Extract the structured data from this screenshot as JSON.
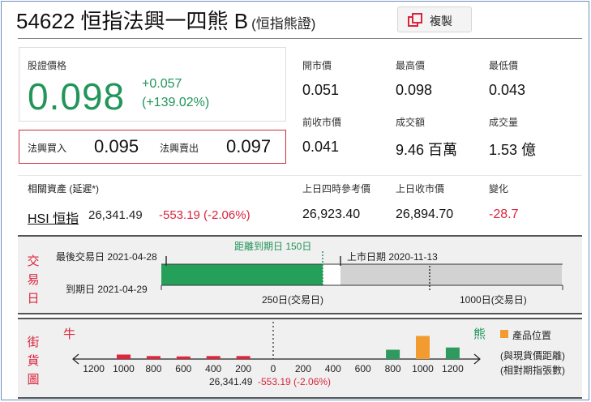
{
  "header": {
    "code_name": "54622 恒指法興一四熊 B",
    "subtitle": "(恒指熊證)",
    "copy_label": "複製"
  },
  "price": {
    "label": "股證價格",
    "value": "0.098",
    "change": "+0.057",
    "change_pct": "(+139.02%)"
  },
  "bid_ask": {
    "bid_label": "法興買入",
    "bid": "0.095",
    "ask_label": "法興賣出",
    "ask": "0.097"
  },
  "stats": [
    {
      "label": "開市價",
      "value": "0.051"
    },
    {
      "label": "最高價",
      "value": "0.098"
    },
    {
      "label": "最低價",
      "value": "0.043"
    },
    {
      "label": "前收市價",
      "value": "0.041"
    },
    {
      "label": "成交額",
      "value": "9.46 百萬"
    },
    {
      "label": "成交量",
      "value": "1.53 億"
    }
  ],
  "underlying": {
    "label": "相關資產 (延遲*)",
    "name": "HSI 恒指",
    "price": "26,341.49",
    "change": "-553.19 (-2.06%)",
    "ref_label": "上日四時參考價",
    "ref_value": "26,923.40",
    "close_label": "上日收市價",
    "close_value": "26,894.70",
    "chg_label": "變化",
    "chg_value": "-28.7"
  },
  "trading": {
    "side_label": [
      "交",
      "易",
      "日"
    ],
    "last_trade": "最後交易日 2021-04-28",
    "days_to_expiry": "距離到期日 150日",
    "listing": "上市日期 2020-11-13",
    "expiry": "到期日 2021-04-29",
    "scale_250": "250日(交易日)",
    "scale_1000": "1000日(交易日)",
    "elapsed_fraction": 0.6
  },
  "street": {
    "side_label": [
      "街",
      "貨",
      "圖"
    ],
    "bull_label": "牛",
    "bear_label": "熊",
    "legend_label": "產品位置",
    "note1": "(與現貨價距離)",
    "note2": "(相對期指張數)",
    "center_text": "26,341.49",
    "center_change": "-553.19 (-2.06%)",
    "ticks": [
      "1200",
      "1000",
      "800",
      "600",
      "400",
      "200",
      "0",
      "200",
      "400",
      "600",
      "800",
      "1000",
      "1200"
    ],
    "bull_bars": [
      {
        "at": "1000",
        "level": 0.12
      },
      {
        "at": "800",
        "level": 0.08
      },
      {
        "at": "600",
        "level": 0.07
      },
      {
        "at": "400",
        "level": 0.08
      },
      {
        "at": "200",
        "level": 0.08
      }
    ],
    "bear_bars": [
      {
        "at": "800",
        "level": 0.25
      },
      {
        "at": "1000",
        "level": 0.62,
        "highlight": true
      },
      {
        "at": "1200",
        "level": 0.31
      }
    ],
    "colors": {
      "bull": "#e0243c",
      "bear": "#2e9a5f",
      "product": "#f29b30"
    }
  }
}
